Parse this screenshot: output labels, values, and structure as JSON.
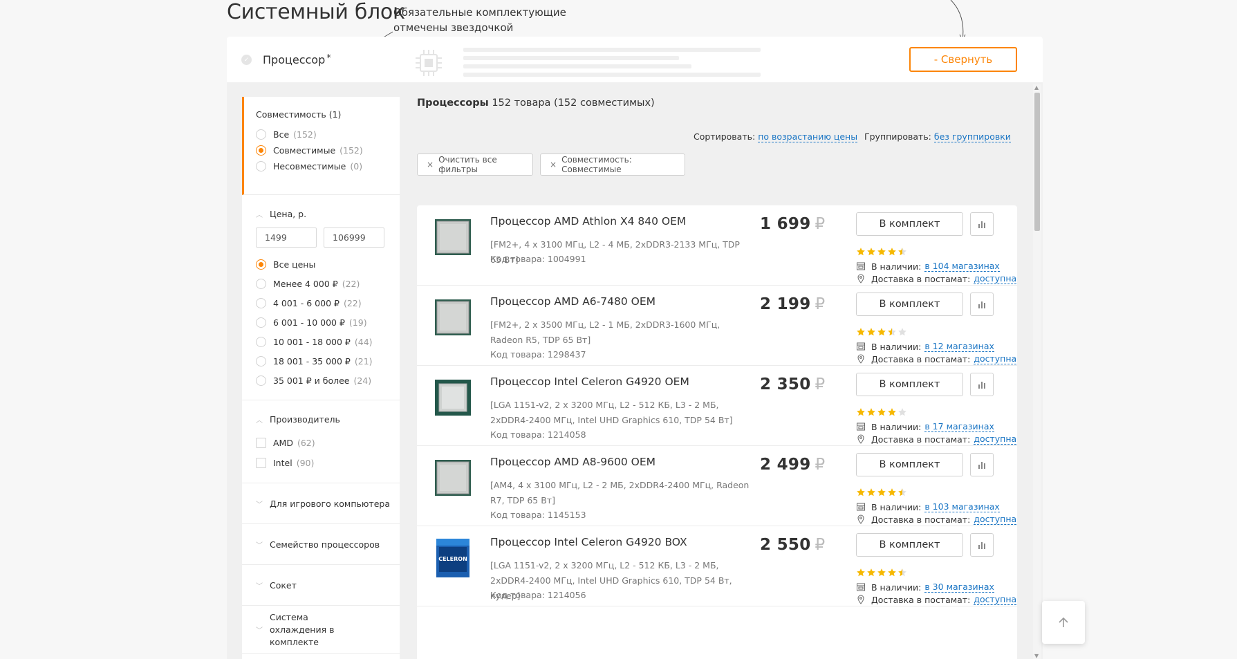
{
  "page": {
    "title": "Системный блок",
    "note_line1": "Обязательные комплектующие",
    "note_line2": "отмечены звездочкой"
  },
  "component": {
    "label": "Процессор",
    "required_mark": "*",
    "collapse_label": "- Свернуть"
  },
  "sidebar": {
    "compat": {
      "title": "Совместимость (1)",
      "options": [
        {
          "label": "Все",
          "count": "(152)",
          "checked": false
        },
        {
          "label": "Совместимые",
          "count": "(152)",
          "checked": true
        },
        {
          "label": "Несовместимые",
          "count": "(0)",
          "checked": false
        }
      ]
    },
    "price": {
      "title": "Цена, р.",
      "min": "1499",
      "max": "106999",
      "options": [
        {
          "label": "Все цены",
          "count": "",
          "checked": true
        },
        {
          "label": "Менее 4 000 ₽",
          "count": "(22)",
          "checked": false
        },
        {
          "label": "4 001 - 6 000 ₽",
          "count": "(22)",
          "checked": false
        },
        {
          "label": "6 001 - 10 000 ₽",
          "count": "(19)",
          "checked": false
        },
        {
          "label": "10 001 - 18 000 ₽",
          "count": "(44)",
          "checked": false
        },
        {
          "label": "18 001 - 35 000 ₽",
          "count": "(21)",
          "checked": false
        },
        {
          "label": "35 001 ₽  и более",
          "count": "(24)",
          "checked": false
        }
      ]
    },
    "maker": {
      "title": "Производитель",
      "options": [
        {
          "label": "AMD",
          "count": "(62)"
        },
        {
          "label": "Intel",
          "count": "(90)"
        }
      ]
    },
    "collapsed": [
      "Для игрового компьютера",
      "Семейство процессоров",
      "Сокет",
      "Система охлаждения в комплекте"
    ]
  },
  "list": {
    "category": "Процессоры",
    "count_text": "152 товара (152 совместимых)",
    "sort_label": "Сортировать:",
    "sort_value": "по возрастанию цены",
    "group_label": "Группировать:",
    "group_value": "без группировки",
    "chips": [
      "Очистить все фильтры",
      "Совместимость: Совместимые"
    ],
    "chip_close": "×"
  },
  "product_ui": {
    "add_label": "В комплект",
    "avail_label": "В наличии:",
    "deliv_label": "Доставка в постамат:",
    "deliv_value": "доступна",
    "currency": "₽"
  },
  "products": [
    {
      "name": "Процессор AMD Athlon X4 840 OEM",
      "desc": "[FM2+, 4 x 3100 МГц, L2 - 4 МБ, 2xDDR3-2133 МГц, TDP 65 Вт]",
      "code": "Код товара: 1004991",
      "price": "1 699",
      "rating": 4.5,
      "stores": "в 104 магазинах",
      "image": "amd-oem"
    },
    {
      "name": "Процессор AMD A6-7480 OEM",
      "desc": "[FM2+, 2 x 3500 МГц, L2 - 1 МБ, 2xDDR3-1600 МГц, Radeon R5, TDP 65 Вт]",
      "code": "Код товара: 1298437",
      "price": "2 199",
      "rating": 3.5,
      "stores": "в 12 магазинах",
      "image": "amd-oem"
    },
    {
      "name": "Процессор Intel Celeron G4920 OEM",
      "desc": "[LGA 1151-v2, 2 x 3200 МГц, L2 - 512 КБ, L3 - 2 МБ, 2xDDR4-2400 МГц, Intel UHD Graphics 610, TDP 54 Вт]",
      "code": "Код товара: 1214058",
      "price": "2 350",
      "rating": 4,
      "stores": "в 17 магазинах",
      "image": "intel-oem"
    },
    {
      "name": "Процессор AMD A8-9600 OEM",
      "desc": "[AM4, 4 x 3100 МГц, L2 - 2 МБ, 2xDDR4-2400 МГц, Radeon R7, TDP 65 Вт]",
      "code": "Код товара: 1145153",
      "price": "2 499",
      "rating": 4.5,
      "stores": "в 103 магазинах",
      "image": "amd-oem"
    },
    {
      "name": "Процессор Intel Celeron G4920 BOX",
      "desc": "[LGA 1151-v2, 2 x 3200 МГц, L2 - 512 КБ, L3 - 2 МБ, 2xDDR4-2400 МГц, Intel UHD Graphics 610, TDP 54 Вт, кулер]",
      "code": "Код товара: 1214056",
      "price": "2 550",
      "rating": 4.5,
      "stores": "в 30 магазинах",
      "image": "intel-box",
      "box_text": "CELERON"
    }
  ],
  "colors": {
    "accent": "#fc8507",
    "link": "#1a75c4",
    "star": "#f6b800",
    "star_empty": "#e0e0e0"
  }
}
